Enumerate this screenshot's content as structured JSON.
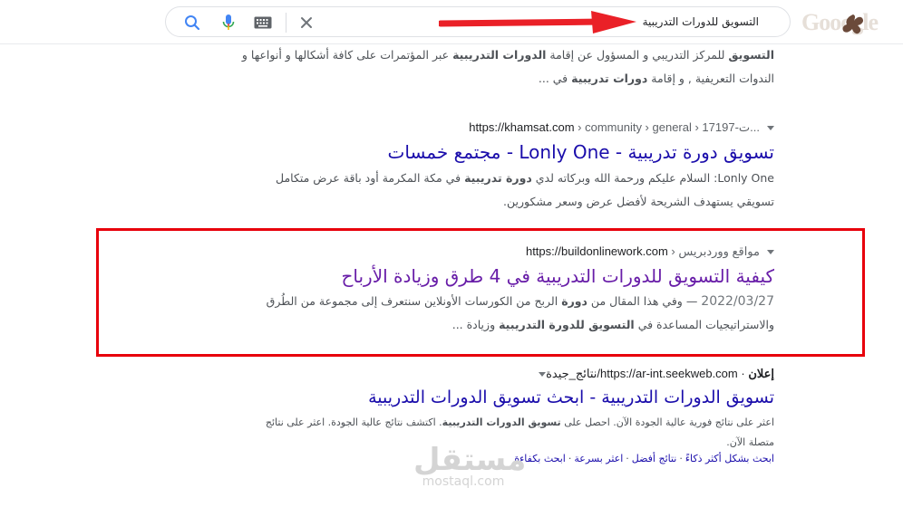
{
  "header": {
    "search_query": "التسويق للدورات التدريبية",
    "icons": [
      "google-logo-icon",
      "close-icon",
      "keyboard-icon",
      "microphone-icon",
      "search-icon"
    ]
  },
  "results": [
    {
      "snippet_line1": "<b>التسويق</b> للمركز التدريبي و المسؤول عن إقامة <b>الدورات التدريبية</b> عبر المؤتمرات على كافة أشكالها و أنواعها و",
      "snippet_line2": "الندوات التعريفية , و إقامة <b>دورات تدريبية</b> في ..."
    },
    {
      "cite_domain": "https://khamsat.com",
      "cite_path": " › community › general › 17197-ت...",
      "title": "تسويق دورة تدريبية - Lonly One - مجتمع خمسات",
      "snippet_line1": "Lonly One: السلام عليكم ورحمة الله وبركاته لدي <b>دورة تدريبية</b> في مكة المكرمة أود باقة عرض متكامل",
      "snippet_line2": "تسويقي يستهدف الشريحة لأفضل عرض وسعر مشكورين."
    },
    {
      "cite_domain": "https://buildonlinework.com",
      "cite_path": " › مواقع ووردبريس",
      "title": "كيفية التسويق للدورات التدريبية في 4 طرق وزيادة الأرباح",
      "date": "2022/03/27",
      "snippet_line1": "وفي هذا المقال من <b>دورة</b> الربح من الكورسات الأونلاين سنتعرف إلى مجموعة من الطُرق",
      "snippet_line2": "والاستراتيجيات المساعدة في <b>التسويق للدورة التدريبية</b> وزيادة ..."
    }
  ],
  "ad": {
    "label": "إعلان",
    "cite_domain": "https://ar-int.seekweb.com",
    "cite_path": "/نتائج_جيدة",
    "title": "تسويق الدورات التدريبية - ابحث تسويق الدورات التدريبية",
    "snippet_line1": "اعثر على نتائج فورية عالية الجودة الآن. احصل على <b>تسويق الدورات التدريبية</b>. اكتشف نتائج عالية الجودة. اعثر على نتائج",
    "snippet_line2": "متصلة الآن.",
    "sitelinks": [
      "ابحث بشكل أكثر ذكاءً",
      "نتائج أفضل",
      "اعثر بسرعة",
      "ابحث بكفاءة"
    ]
  },
  "watermark": {
    "arabic": "مستقل",
    "latin": "mostaql.com"
  },
  "colors": {
    "link": "#1a0dab",
    "visited": "#681da8",
    "annotation_red": "#e8000b"
  }
}
